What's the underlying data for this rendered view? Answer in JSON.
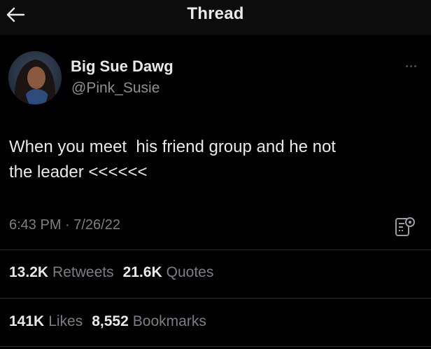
{
  "header": {
    "title": "Thread",
    "back_icon": "arrow-left-icon"
  },
  "author": {
    "display_name": "Big Sue Dawg",
    "handle": "@Pink_Susie",
    "more_icon": "more-horizontal-icon"
  },
  "tweet": {
    "text": "When you meet  his friend group and he not\nthe leader <<<<<<",
    "timestamp": "6:43 PM · 7/26/22",
    "analytics_icon": "analytics-icon"
  },
  "stats": {
    "retweets_count": "13.2K",
    "retweets_label": "Retweets",
    "quotes_count": "21.6K",
    "quotes_label": "Quotes",
    "likes_count": "141K",
    "likes_label": "Likes",
    "bookmarks_count": "8,552",
    "bookmarks_label": "Bookmarks"
  },
  "colors": {
    "background": "#000000",
    "header_background": "#0c0c0c",
    "primary_text": "#e7e9ea",
    "secondary_text": "#7b7f83",
    "divider": "#2a2d30"
  }
}
